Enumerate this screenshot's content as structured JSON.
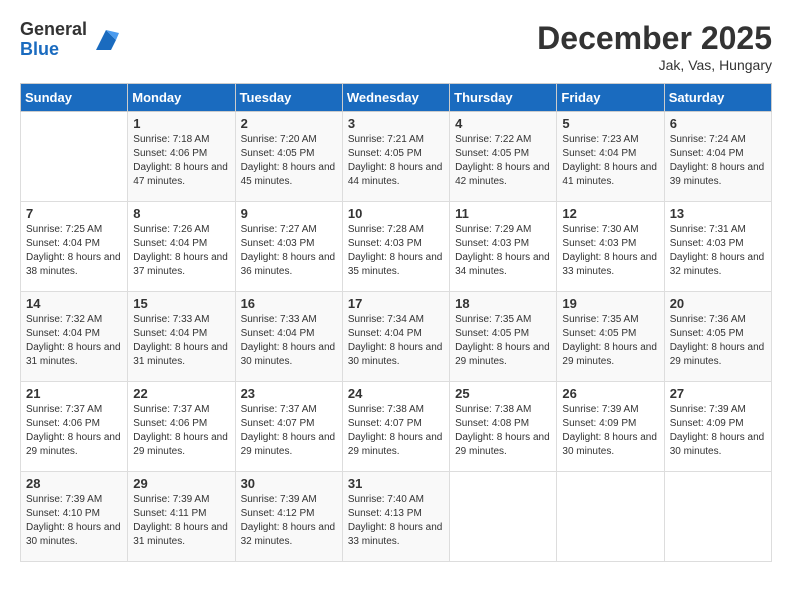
{
  "logo": {
    "general": "General",
    "blue": "Blue"
  },
  "title": {
    "month_year": "December 2025",
    "location": "Jak, Vas, Hungary"
  },
  "weekdays": [
    "Sunday",
    "Monday",
    "Tuesday",
    "Wednesday",
    "Thursday",
    "Friday",
    "Saturday"
  ],
  "weeks": [
    [
      {
        "day": "",
        "sunrise": "",
        "sunset": "",
        "daylight": ""
      },
      {
        "day": "1",
        "sunrise": "Sunrise: 7:18 AM",
        "sunset": "Sunset: 4:06 PM",
        "daylight": "Daylight: 8 hours and 47 minutes."
      },
      {
        "day": "2",
        "sunrise": "Sunrise: 7:20 AM",
        "sunset": "Sunset: 4:05 PM",
        "daylight": "Daylight: 8 hours and 45 minutes."
      },
      {
        "day": "3",
        "sunrise": "Sunrise: 7:21 AM",
        "sunset": "Sunset: 4:05 PM",
        "daylight": "Daylight: 8 hours and 44 minutes."
      },
      {
        "day": "4",
        "sunrise": "Sunrise: 7:22 AM",
        "sunset": "Sunset: 4:05 PM",
        "daylight": "Daylight: 8 hours and 42 minutes."
      },
      {
        "day": "5",
        "sunrise": "Sunrise: 7:23 AM",
        "sunset": "Sunset: 4:04 PM",
        "daylight": "Daylight: 8 hours and 41 minutes."
      },
      {
        "day": "6",
        "sunrise": "Sunrise: 7:24 AM",
        "sunset": "Sunset: 4:04 PM",
        "daylight": "Daylight: 8 hours and 39 minutes."
      }
    ],
    [
      {
        "day": "7",
        "sunrise": "Sunrise: 7:25 AM",
        "sunset": "Sunset: 4:04 PM",
        "daylight": "Daylight: 8 hours and 38 minutes."
      },
      {
        "day": "8",
        "sunrise": "Sunrise: 7:26 AM",
        "sunset": "Sunset: 4:04 PM",
        "daylight": "Daylight: 8 hours and 37 minutes."
      },
      {
        "day": "9",
        "sunrise": "Sunrise: 7:27 AM",
        "sunset": "Sunset: 4:03 PM",
        "daylight": "Daylight: 8 hours and 36 minutes."
      },
      {
        "day": "10",
        "sunrise": "Sunrise: 7:28 AM",
        "sunset": "Sunset: 4:03 PM",
        "daylight": "Daylight: 8 hours and 35 minutes."
      },
      {
        "day": "11",
        "sunrise": "Sunrise: 7:29 AM",
        "sunset": "Sunset: 4:03 PM",
        "daylight": "Daylight: 8 hours and 34 minutes."
      },
      {
        "day": "12",
        "sunrise": "Sunrise: 7:30 AM",
        "sunset": "Sunset: 4:03 PM",
        "daylight": "Daylight: 8 hours and 33 minutes."
      },
      {
        "day": "13",
        "sunrise": "Sunrise: 7:31 AM",
        "sunset": "Sunset: 4:03 PM",
        "daylight": "Daylight: 8 hours and 32 minutes."
      }
    ],
    [
      {
        "day": "14",
        "sunrise": "Sunrise: 7:32 AM",
        "sunset": "Sunset: 4:04 PM",
        "daylight": "Daylight: 8 hours and 31 minutes."
      },
      {
        "day": "15",
        "sunrise": "Sunrise: 7:33 AM",
        "sunset": "Sunset: 4:04 PM",
        "daylight": "Daylight: 8 hours and 31 minutes."
      },
      {
        "day": "16",
        "sunrise": "Sunrise: 7:33 AM",
        "sunset": "Sunset: 4:04 PM",
        "daylight": "Daylight: 8 hours and 30 minutes."
      },
      {
        "day": "17",
        "sunrise": "Sunrise: 7:34 AM",
        "sunset": "Sunset: 4:04 PM",
        "daylight": "Daylight: 8 hours and 30 minutes."
      },
      {
        "day": "18",
        "sunrise": "Sunrise: 7:35 AM",
        "sunset": "Sunset: 4:05 PM",
        "daylight": "Daylight: 8 hours and 29 minutes."
      },
      {
        "day": "19",
        "sunrise": "Sunrise: 7:35 AM",
        "sunset": "Sunset: 4:05 PM",
        "daylight": "Daylight: 8 hours and 29 minutes."
      },
      {
        "day": "20",
        "sunrise": "Sunrise: 7:36 AM",
        "sunset": "Sunset: 4:05 PM",
        "daylight": "Daylight: 8 hours and 29 minutes."
      }
    ],
    [
      {
        "day": "21",
        "sunrise": "Sunrise: 7:37 AM",
        "sunset": "Sunset: 4:06 PM",
        "daylight": "Daylight: 8 hours and 29 minutes."
      },
      {
        "day": "22",
        "sunrise": "Sunrise: 7:37 AM",
        "sunset": "Sunset: 4:06 PM",
        "daylight": "Daylight: 8 hours and 29 minutes."
      },
      {
        "day": "23",
        "sunrise": "Sunrise: 7:37 AM",
        "sunset": "Sunset: 4:07 PM",
        "daylight": "Daylight: 8 hours and 29 minutes."
      },
      {
        "day": "24",
        "sunrise": "Sunrise: 7:38 AM",
        "sunset": "Sunset: 4:07 PM",
        "daylight": "Daylight: 8 hours and 29 minutes."
      },
      {
        "day": "25",
        "sunrise": "Sunrise: 7:38 AM",
        "sunset": "Sunset: 4:08 PM",
        "daylight": "Daylight: 8 hours and 29 minutes."
      },
      {
        "day": "26",
        "sunrise": "Sunrise: 7:39 AM",
        "sunset": "Sunset: 4:09 PM",
        "daylight": "Daylight: 8 hours and 30 minutes."
      },
      {
        "day": "27",
        "sunrise": "Sunrise: 7:39 AM",
        "sunset": "Sunset: 4:09 PM",
        "daylight": "Daylight: 8 hours and 30 minutes."
      }
    ],
    [
      {
        "day": "28",
        "sunrise": "Sunrise: 7:39 AM",
        "sunset": "Sunset: 4:10 PM",
        "daylight": "Daylight: 8 hours and 30 minutes."
      },
      {
        "day": "29",
        "sunrise": "Sunrise: 7:39 AM",
        "sunset": "Sunset: 4:11 PM",
        "daylight": "Daylight: 8 hours and 31 minutes."
      },
      {
        "day": "30",
        "sunrise": "Sunrise: 7:39 AM",
        "sunset": "Sunset: 4:12 PM",
        "daylight": "Daylight: 8 hours and 32 minutes."
      },
      {
        "day": "31",
        "sunrise": "Sunrise: 7:40 AM",
        "sunset": "Sunset: 4:13 PM",
        "daylight": "Daylight: 8 hours and 33 minutes."
      },
      {
        "day": "",
        "sunrise": "",
        "sunset": "",
        "daylight": ""
      },
      {
        "day": "",
        "sunrise": "",
        "sunset": "",
        "daylight": ""
      },
      {
        "day": "",
        "sunrise": "",
        "sunset": "",
        "daylight": ""
      }
    ]
  ]
}
